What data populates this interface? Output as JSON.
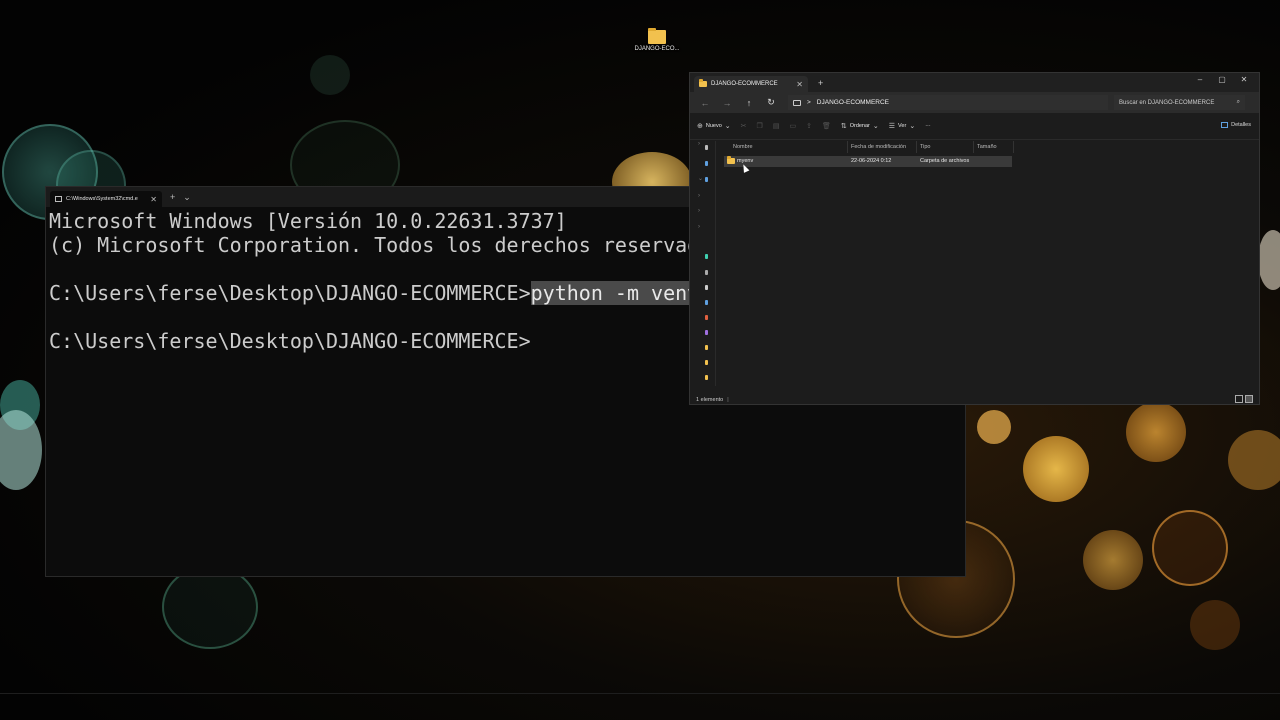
{
  "desktop": {
    "icon_label": "DJANGO-ECO...",
    "icon": "folder-icon"
  },
  "terminal": {
    "tab_title": "C:\\Windows\\System32\\cmd.e",
    "new_tab": "+",
    "dropdown": "⌄",
    "close": "✕",
    "lines": {
      "l1": "Microsoft Windows [Versión 10.0.22631.3737]",
      "l2": "(c) Microsoft Corporation. Todos los derechos reservados.",
      "l3_prompt": "C:\\Users\\ferse\\Desktop\\DJANGO-ECOMMERCE>",
      "l3_cmd": "python -m venv myenv",
      "l4_prompt": "C:\\Users\\ferse\\Desktop\\DJANGO-ECOMMERCE>"
    }
  },
  "explorer": {
    "tab_title": "DJANGO-ECOMMERCE",
    "new_tab": "+",
    "window_controls": {
      "minimize": "–",
      "maximize": "▢",
      "close": "✕"
    },
    "address": {
      "separator": ">",
      "path": "DJANGO-ECOMMERCE",
      "search_placeholder": "Buscar en DJANGO-ECOMMERCE"
    },
    "commands": {
      "new": "Nuevo",
      "sort": "Ordenar",
      "view": "Ver",
      "more": "···",
      "details": "Detalles"
    },
    "columns": {
      "name": "Nombre",
      "modified": "Fecha de modificación",
      "type": "Tipo",
      "size": "Tamaño"
    },
    "rows": [
      {
        "name": "myenv",
        "modified": "22-06-2024 0:12",
        "type": "Carpeta de archivos",
        "size": ""
      }
    ],
    "status": "1 elemento"
  }
}
